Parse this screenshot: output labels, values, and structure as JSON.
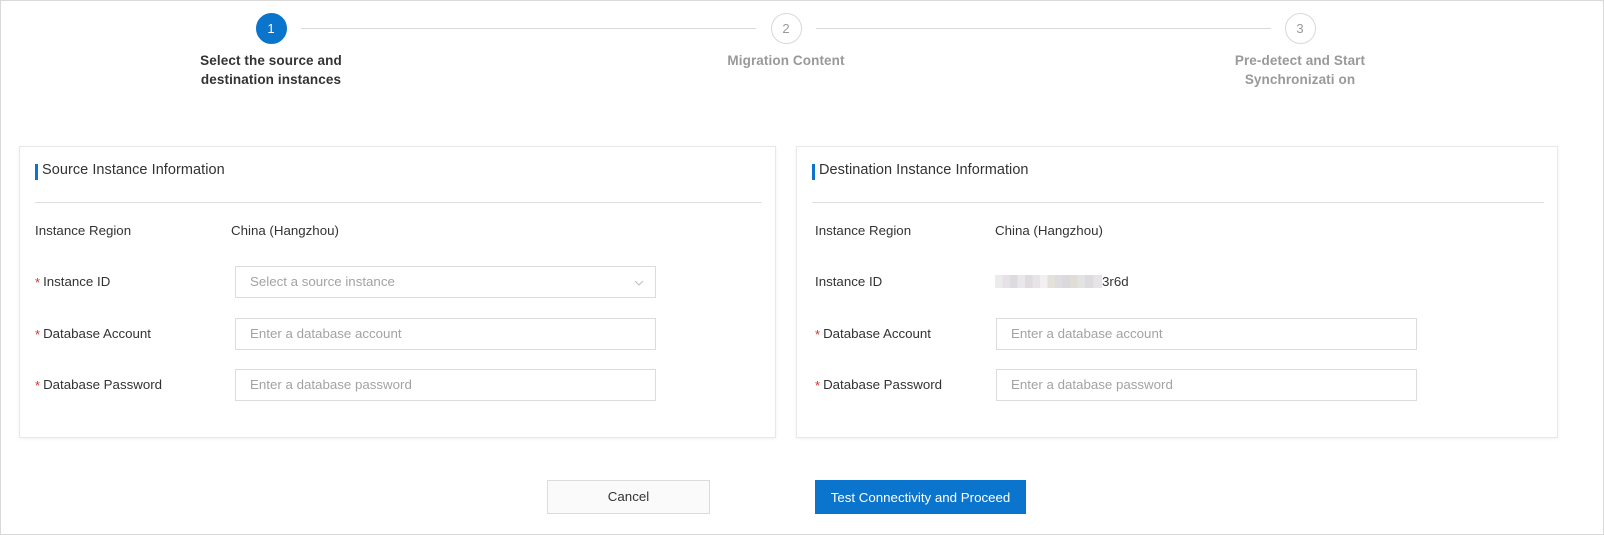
{
  "stepper": {
    "steps": [
      {
        "number": "1",
        "label": "Select the source and destination instances",
        "state": "active"
      },
      {
        "number": "2",
        "label": "Migration Content",
        "state": "inactive"
      },
      {
        "number": "3",
        "label": "Pre-detect and Start Synchronizati on",
        "state": "inactive"
      }
    ]
  },
  "source_panel": {
    "title": "Source Instance Information",
    "region_label": "Instance Region",
    "region_value": "China (Hangzhou)",
    "instance_id_label": "Instance ID",
    "instance_id_placeholder": "Select a source instance",
    "account_label": "Database Account",
    "account_placeholder": "Enter a database account",
    "password_label": "Database Password",
    "password_placeholder": "Enter a database password"
  },
  "destination_panel": {
    "title": "Destination Instance Information",
    "region_label": "Instance Region",
    "region_value": "China (Hangzhou)",
    "instance_id_label": "Instance ID",
    "instance_id_value_suffix": "3r6d",
    "account_label": "Database Account",
    "account_placeholder": "Enter a database account",
    "password_label": "Database Password",
    "password_placeholder": "Enter a database password"
  },
  "footer": {
    "cancel_label": "Cancel",
    "primary_label": "Test Connectivity and Proceed"
  },
  "colors": {
    "accent": "#0b74cc",
    "required_star": "#d93026",
    "placeholder_text": "#a3a3a3",
    "body_text": "#333333",
    "inactive_step": "#999999",
    "border": "#dcdcdc"
  }
}
